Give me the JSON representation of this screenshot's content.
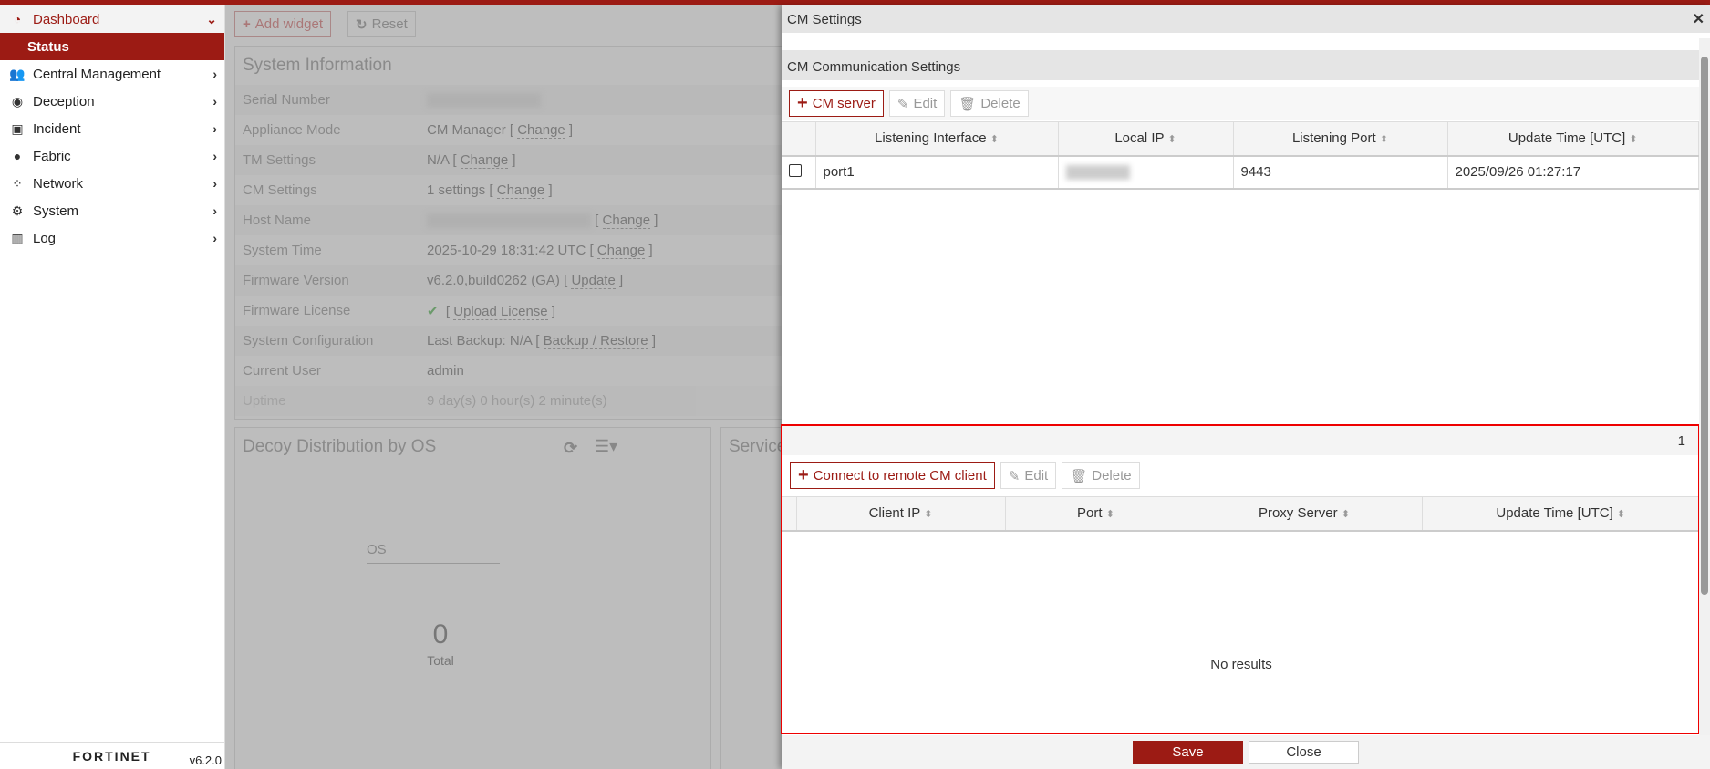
{
  "sidebar": {
    "items": [
      {
        "label": "Dashboard",
        "icon": "dashboard-icon"
      },
      {
        "label": "Status"
      },
      {
        "label": "Central Management",
        "icon": "users-icon"
      },
      {
        "label": "Deception",
        "icon": "deception-icon"
      },
      {
        "label": "Incident",
        "icon": "incident-icon"
      },
      {
        "label": "Fabric",
        "icon": "fabric-icon"
      },
      {
        "label": "Network",
        "icon": "network-icon"
      },
      {
        "label": "System",
        "icon": "gear-icon"
      },
      {
        "label": "Log",
        "icon": "chart-icon"
      }
    ],
    "logo": "FORTINET",
    "version": "v6.2.0"
  },
  "toolbar": {
    "add_widget": "Add widget",
    "reset": "Reset"
  },
  "system_info": {
    "title": "System Information",
    "rows": [
      {
        "k": "Serial Number"
      },
      {
        "k": "Appliance Mode",
        "v": "CM Manager",
        "link": "Change"
      },
      {
        "k": "TM Settings",
        "v": "N/A",
        "link": "Change"
      },
      {
        "k": "CM Settings",
        "v": "1 settings",
        "link": "Change"
      },
      {
        "k": "Host Name",
        "link": "Change"
      },
      {
        "k": "System Time",
        "v": "2025-10-29 18:31:42 UTC",
        "link": "Change"
      },
      {
        "k": "Firmware Version",
        "v": "v6.2.0,build0262 (GA)",
        "link": "Update"
      },
      {
        "k": "Firmware License",
        "link": "Upload License"
      },
      {
        "k": "System Configuration",
        "v": "Last Backup: N/A",
        "link": "Backup / Restore"
      },
      {
        "k": "Current User",
        "v": "admin"
      },
      {
        "k": "Uptime",
        "v": "9 day(s) 0 hour(s) 2 minute(s)"
      }
    ]
  },
  "decoy": {
    "title": "Decoy Distribution by OS",
    "legend": "OS",
    "total": "0",
    "total_label": "Total"
  },
  "service": {
    "title": "Service"
  },
  "modal": {
    "title": "CM Settings",
    "section": "CM Communication Settings",
    "server_toolbar": {
      "add": "CM server",
      "edit": "Edit",
      "delete": "Delete"
    },
    "server_columns": [
      "Listening Interface",
      "Local IP",
      "Listening Port",
      "Update Time [UTC]"
    ],
    "server_rows": [
      {
        "interface": "port1",
        "port": "9443",
        "time": "2025/09/26 01:27:17"
      }
    ],
    "client_count": "1",
    "client_toolbar": {
      "add": "Connect to remote CM client",
      "edit": "Edit",
      "delete": "Delete"
    },
    "client_columns": [
      "Client IP",
      "Port",
      "Proxy Server",
      "Update Time [UTC]"
    ],
    "no_results": "No results",
    "save": "Save",
    "close": "Close"
  }
}
